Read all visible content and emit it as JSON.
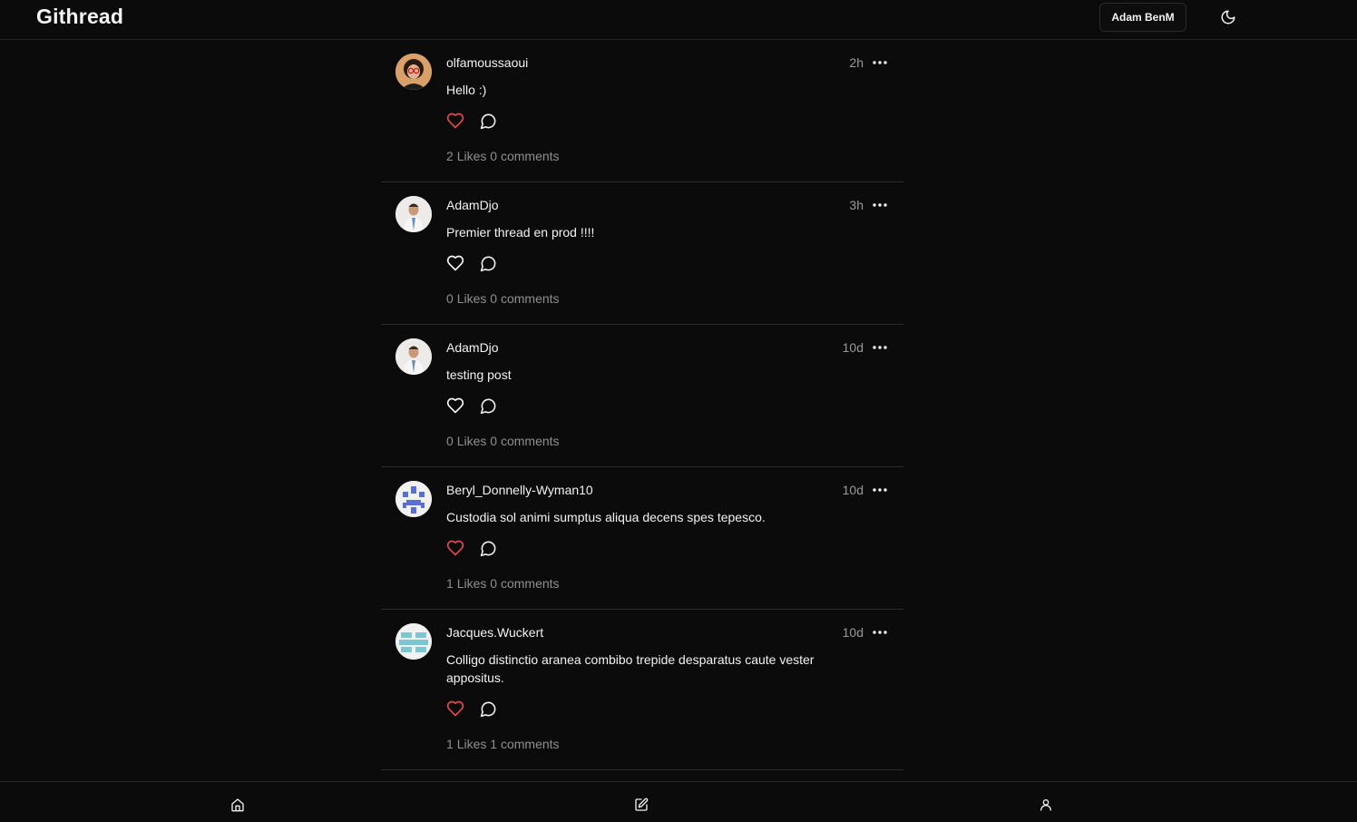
{
  "app": {
    "title": "Githread"
  },
  "header": {
    "user_label": "Adam BenM",
    "theme_icon": "moon-icon"
  },
  "colors": {
    "like_active": "#e5484d",
    "background": "#0b0b0b",
    "muted": "#8f8f8f"
  },
  "posts": [
    {
      "username": "olfamoussaoui",
      "time": "2h",
      "text": "Hello :)",
      "liked": true,
      "likes": "2",
      "comments": "0",
      "likes_label": "Likes",
      "comments_label": "comments"
    },
    {
      "username": "AdamDjo",
      "time": "3h",
      "text": "Premier thread en prod !!!!",
      "liked": false,
      "likes": "0",
      "comments": "0",
      "likes_label": "Likes",
      "comments_label": "comments"
    },
    {
      "username": "AdamDjo",
      "time": "10d",
      "text": "testing post",
      "liked": false,
      "likes": "0",
      "comments": "0",
      "likes_label": "Likes",
      "comments_label": "comments"
    },
    {
      "username": "Beryl_Donnelly-Wyman10",
      "time": "10d",
      "text": "Custodia sol animi sumptus aliqua decens spes tepesco.",
      "liked": true,
      "likes": "1",
      "comments": "0",
      "likes_label": "Likes",
      "comments_label": "comments"
    },
    {
      "username": "Jacques.Wuckert",
      "time": "10d",
      "text": "Colligo distinctio aranea combibo trepide desparatus caute vester appositus.",
      "liked": true,
      "likes": "1",
      "comments": "1",
      "likes_label": "Likes",
      "comments_label": "comments"
    }
  ],
  "bottom_nav": {
    "items": [
      "home-icon",
      "edit-icon",
      "user-icon"
    ]
  }
}
